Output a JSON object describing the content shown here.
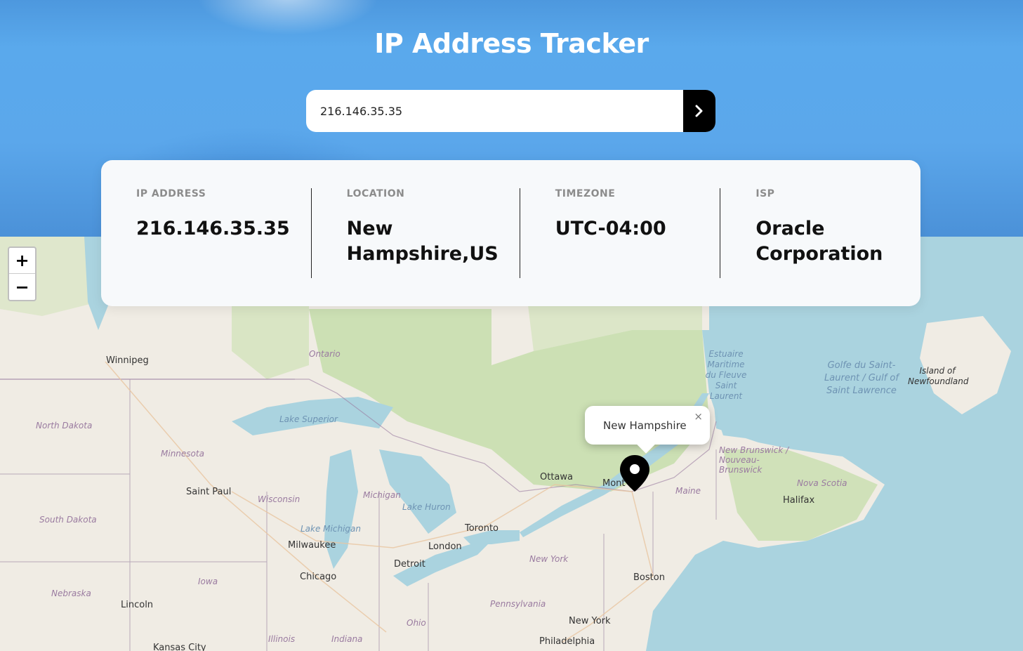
{
  "app": {
    "title": "IP Address Tracker"
  },
  "search": {
    "value": "216.146.35.35",
    "button_icon": "chevron-right-icon"
  },
  "info": {
    "ip_label": "IP ADDRESS",
    "ip_value": "216.146.35.35",
    "location_label": "LOCATION",
    "location_value": "New Hampshire,US",
    "timezone_label": "TIMEZONE",
    "timezone_value": "UTC-04:00",
    "isp_label": "ISP",
    "isp_value": "Oracle Corporation"
  },
  "map": {
    "zoom_in": "+",
    "zoom_out": "−",
    "popup": "New Hampshire",
    "popup_close": "×",
    "marker_icon": "map-pin-icon",
    "labels": {
      "winnipeg": "Winnipeg",
      "ontario": "Ontario",
      "north_dakota": "North Dakota",
      "minnesota": "Minnesota",
      "lake_superior": "Lake Superior",
      "saint_paul": "Saint Paul",
      "wisconsin": "Wisconsin",
      "michigan": "Michigan",
      "lake_huron": "Lake Huron",
      "south_dakota": "South Dakota",
      "lake_michigan": "Lake Michigan",
      "milwaukee": "Milwaukee",
      "toronto": "Toronto",
      "london": "London",
      "detroit": "Detroit",
      "chicago": "Chicago",
      "iowa": "Iowa",
      "nebraska": "Nebraska",
      "lincoln": "Lincoln",
      "kansas_city": "Kansas City",
      "illinois": "Illinois",
      "indiana": "Indiana",
      "ohio": "Ohio",
      "pennsylvania": "Pennsylvania",
      "new_york_state": "New York",
      "new_york_city": "New York",
      "philadelphia": "Philadelphia",
      "boston": "Boston",
      "maine": "Maine",
      "ottawa": "Ottawa",
      "montreal": "Mont",
      "halifax": "Halifax",
      "nova_scotia": "Nova Scotia",
      "new_brunswick": "New Brunswick / Nouveau-Brunswick",
      "estuaire": "Estuaire Maritime du Fleuve Saint Laurent",
      "golfe": "Golfe du Saint-Laurent / Gulf of Saint Lawrence",
      "newfoundland": "Island of Newfoundland"
    }
  },
  "colors": {
    "header_blue": "#5aa9ec",
    "card_bg": "#f7f9fb",
    "water": "#aad3df",
    "forest": "#c8dfae",
    "land": "#f0ece4"
  }
}
